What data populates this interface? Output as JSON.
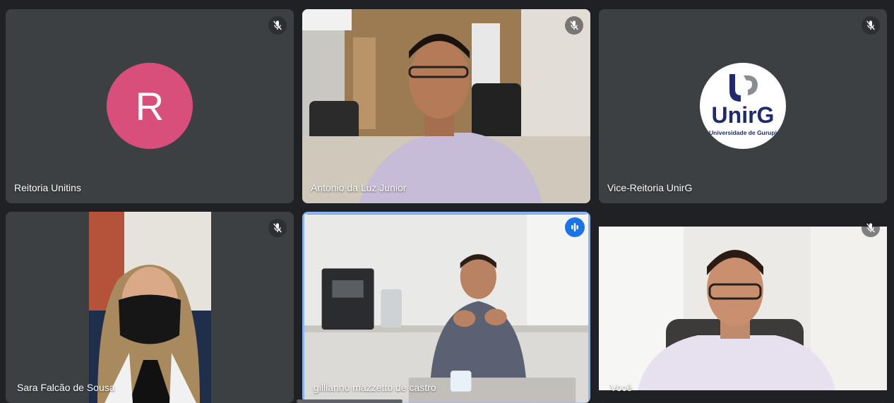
{
  "colors": {
    "background": "#202124",
    "tile": "#3c4043",
    "avatar_r": "#d94f7c",
    "speaking_border": "#8ab4f8",
    "speaking_badge": "#1a73e8",
    "unirg_navy": "#1d2b6e"
  },
  "participants": [
    {
      "name": "Reitoria Unitins",
      "avatar_letter": "R",
      "mic": "muted",
      "mic_icon": "mic-off-icon"
    },
    {
      "name": "Antonio da Luz Junior",
      "mic": "muted",
      "mic_icon": "mic-off-icon",
      "video": "on"
    },
    {
      "name": "Vice-Reitoria UnirG",
      "mic": "muted",
      "mic_icon": "mic-off-icon",
      "logo": {
        "wordmark": "UnirG",
        "tagline": "Universidade de Gurupi"
      }
    },
    {
      "name": "Sara Falcão de Sousa",
      "mic": "muted",
      "mic_icon": "mic-off-icon",
      "video": "on"
    },
    {
      "name": "gillianno mazzetto de castro",
      "mic": "speaking",
      "mic_icon": "speaking-indicator-icon",
      "video": "on"
    },
    {
      "name": "Você",
      "mic": "muted",
      "mic_icon": "mic-off-icon",
      "video": "on"
    }
  ]
}
